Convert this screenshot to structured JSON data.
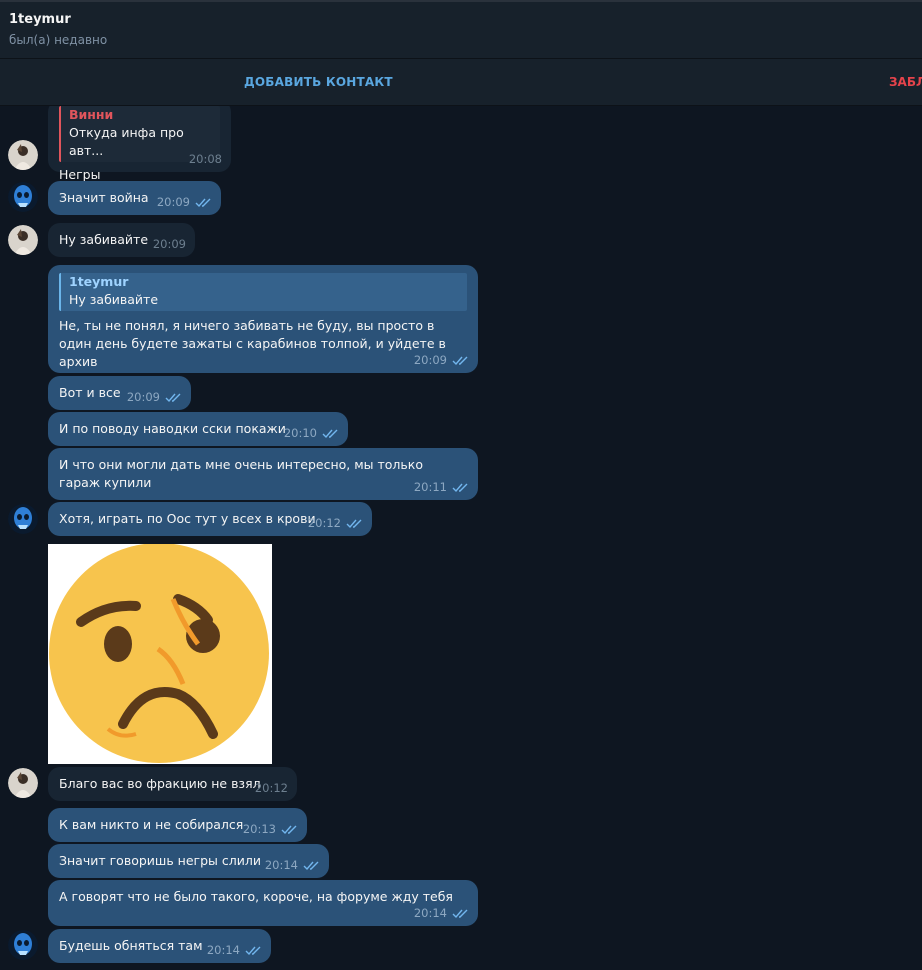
{
  "header": {
    "name": "1teymur",
    "status": "был(а) недавно"
  },
  "actions": {
    "add_contact": "ДОБАВИТЬ КОНТАКТ",
    "block": "ЗАБЛ"
  },
  "messages": [
    {
      "dir": "in",
      "reply_name": "Винни",
      "reply_text": "Откуда инфа про авт...",
      "text": "Негры",
      "time": "20:08"
    },
    {
      "dir": "out",
      "text": "Значит война",
      "time": "20:09"
    },
    {
      "dir": "in",
      "text": "Ну забивайте",
      "time": "20:09"
    },
    {
      "dir": "out",
      "reply_name": "1teymur",
      "reply_text": "Ну забивайте",
      "text": "Не, ты не понял, я ничего забивать не буду, вы просто в один день будете зажаты с карабинов толпой, и уйдете в архив",
      "time": "20:09"
    },
    {
      "dir": "out",
      "text": "Вот и все",
      "time": "20:09"
    },
    {
      "dir": "out",
      "text": "И по поводу наводки сски покажи",
      "time": "20:10"
    },
    {
      "dir": "out",
      "text": "И что они могли дать мне очень интересно, мы только гараж купили",
      "time": "20:11"
    },
    {
      "dir": "out",
      "text": "Хотя, играть по Оос тут у всех в крови",
      "time": "20:12"
    },
    {
      "dir": "in",
      "text": "Благо вас во фракцию не взял",
      "time": "20:12"
    },
    {
      "dir": "out",
      "text": "К вам никто и не собирался",
      "time": "20:13"
    },
    {
      "dir": "out",
      "text": "Значит говоришь негры слили",
      "time": "20:14"
    },
    {
      "dir": "out",
      "text": "А говорят что не было такого, короче, на форуме жду тебя",
      "time": "20:14"
    },
    {
      "dir": "out",
      "text": "Будешь обняться там",
      "time": "20:14"
    }
  ],
  "colors": {
    "background": "#0e1621",
    "incoming": "#182533",
    "outgoing": "#2b5278",
    "accent": "#5aa7e0",
    "danger": "#e5434b"
  },
  "icons": {
    "read_receipt": "double-check-icon",
    "sticker": "worried-face-sticker"
  }
}
